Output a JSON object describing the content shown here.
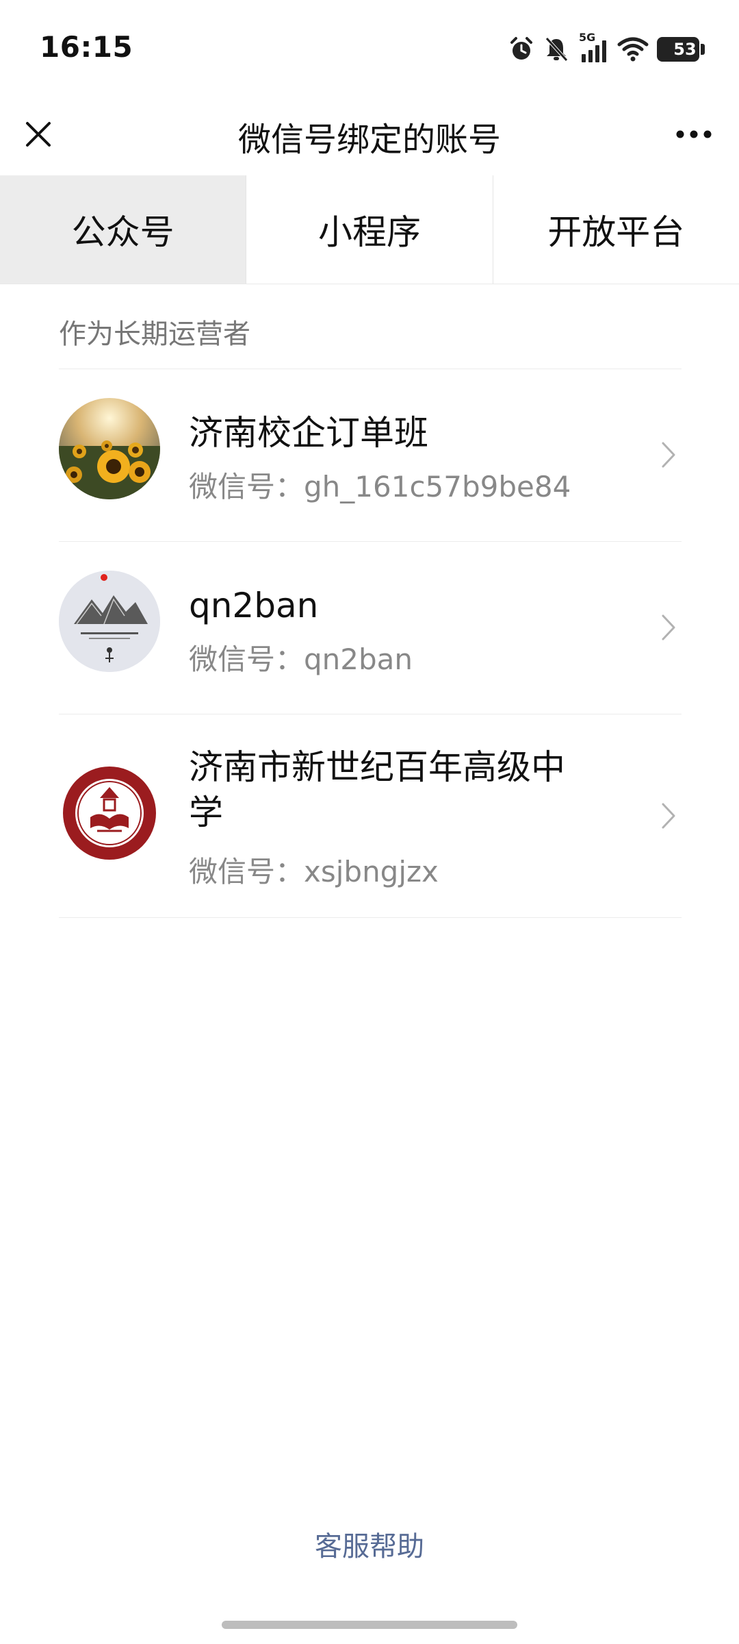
{
  "status_bar": {
    "time": "16:15",
    "network": "5G",
    "battery": "53",
    "icons": [
      "alarm-icon",
      "mute-bell-icon",
      "signal-icon",
      "wifi-icon",
      "battery-icon"
    ]
  },
  "nav": {
    "title": "微信号绑定的账号",
    "close_icon": "close-icon",
    "more_icon": "more-icon"
  },
  "tabs": [
    {
      "label": "公众号",
      "active": true
    },
    {
      "label": "小程序",
      "active": false
    },
    {
      "label": "开放平台",
      "active": false
    }
  ],
  "section_label": "作为长期运营者",
  "accounts": [
    {
      "name": "济南校企订单班",
      "id": "微信号：gh_161c57b9be84"
    },
    {
      "name": "qn2ban",
      "id": "微信号：qn2ban"
    },
    {
      "name": "济南市新世纪百年高级中\n学",
      "id": "微信号：xsjbngjzx"
    }
  ],
  "footer": {
    "help_link": "客服帮助"
  },
  "colors": {
    "link": "#576b95",
    "active_tab_bg": "#ececec",
    "secondary_text": "#888888",
    "emblem_red": "#9b1c1f"
  }
}
